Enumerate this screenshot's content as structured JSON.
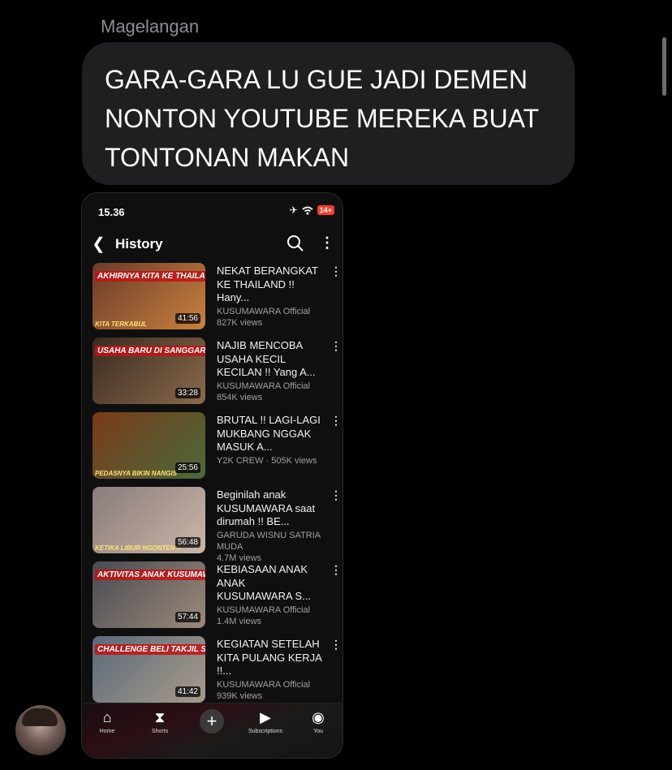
{
  "chat": {
    "sender": "Magelangan",
    "message": "GARA-GARA LU GUE JADI DEMEN NONTON YOUTUBE MEREKA BUAT TONTONAN MAKAN"
  },
  "phone": {
    "status": {
      "time": "15.36",
      "battery": "14+"
    },
    "header": {
      "title": "History"
    },
    "videos": [
      {
        "title": "NEKAT BERANGKAT KE THAILAND !! Hany...",
        "channel": "KUSUMAWARA Official",
        "views": "827K views",
        "duration": "41:56",
        "thumb_text": "AKHIRNYA KITA KE THAILAND!!",
        "thumb_sub": "KITA TERKABUL",
        "thumb_colors": [
          "#6b3a2a",
          "#c9823e"
        ]
      },
      {
        "title": "NAJIB MENCOBA USAHA KECIL KECILAN !! Yang A...",
        "channel": "KUSUMAWARA Official",
        "views": "854K views",
        "duration": "33:28",
        "thumb_text": "USAHA BARU DI SANGGAR!!",
        "thumb_sub": "",
        "thumb_colors": [
          "#3a2a22",
          "#8a6a4a"
        ]
      },
      {
        "title": "BRUTAL !! LAGI-LAGI MUKBANG NGGAK MASUK A...",
        "channel": "Y2K CREW · 505K views",
        "views": "",
        "duration": "25:56",
        "thumb_text": "",
        "thumb_sub": "PEDASNYA BIKIN NANGIS",
        "thumb_colors": [
          "#7a3a1a",
          "#4a6a3a"
        ]
      },
      {
        "title": "Beginilah anak KUSUMAWARA saat dirumah !! BE...",
        "channel": "GARUDA WISNU SATRIA MUDA",
        "views": "4.7M views",
        "duration": "56:48",
        "thumb_text": "",
        "thumb_sub": "KETIKA LIBUR NGONTEN !!",
        "thumb_colors": [
          "#8a7a7a",
          "#c9b8a8"
        ]
      },
      {
        "title": "KEBIASAAN ANAK ANAK KUSUMAWARA S...",
        "channel": "KUSUMAWARA Official",
        "views": "1.4M views",
        "duration": "57:44",
        "thumb_text": "AKTIVITAS ANAK KUSUMAWARA!!",
        "thumb_sub": "",
        "thumb_colors": [
          "#4a4a52",
          "#9a8a7a"
        ]
      },
      {
        "title": "KEGIATAN SETELAH KITA PULANG KERJA !!...",
        "channel": "KUSUMAWARA Official",
        "views": "939K views",
        "duration": "41:42",
        "thumb_text": "CHALLENGE BELI TAKJIL SENDIRI!!",
        "thumb_sub": "",
        "thumb_colors": [
          "#5a6a7a",
          "#a89a8a"
        ]
      }
    ],
    "nav": {
      "home": "Home",
      "shorts": "Shorts",
      "subscriptions": "Subscriptions",
      "you": "You"
    }
  },
  "colors": {
    "bubble": "#1f1f21",
    "accent_red": "#ff0000"
  }
}
